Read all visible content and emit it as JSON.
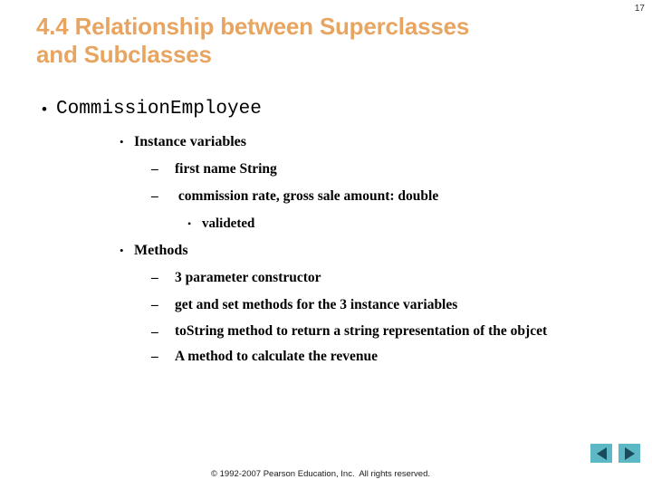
{
  "slide": {
    "page_number": "17",
    "title_lines": [
      "4.4 Relationship between Superclasses",
      "and Subclasses"
    ],
    "title_color": "#e8a561",
    "background_color": "#ffffff"
  },
  "outline": {
    "level1": {
      "bullet_glyph": "•",
      "text": "CommissionEmployee"
    },
    "instance_variables": {
      "bullet_glyph": "•",
      "label": "Instance variables",
      "items": [
        {
          "dash_glyph": "–",
          "text": "first name String"
        },
        {
          "dash_glyph": "–",
          "text": " commission rate, gross sale amount: double"
        }
      ],
      "sub_items": [
        {
          "bullet_glyph": "•",
          "text": "valideted"
        }
      ]
    },
    "methods": {
      "bullet_glyph": "•",
      "label": "Methods",
      "items": [
        {
          "dash_glyph": "–",
          "text": "3 parameter constructor"
        },
        {
          "dash_glyph": "–",
          "text": "get and set methods for the 3 instance variables"
        },
        {
          "dash_glyph": "–",
          "text": "toString method to return a string representation of the objcet"
        },
        {
          "dash_glyph": "–",
          "text": "A method to calculate the revenue"
        }
      ]
    }
  },
  "footer": {
    "copyright": "© 1992-2007 Pearson Education, Inc.  All rights reserved."
  },
  "navigation": {
    "previous_label": "Previous slide",
    "next_label": "Next slide",
    "button_color": "#5cb8c4",
    "arrow_color": "#1b4a5a"
  }
}
